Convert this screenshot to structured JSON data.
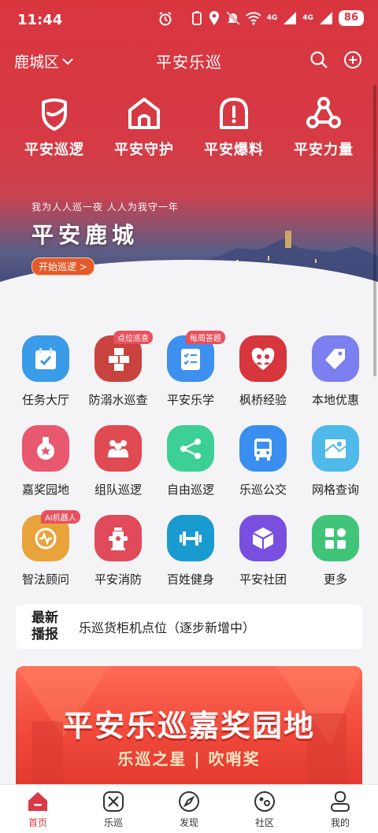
{
  "status_bar": {
    "time": "11:44",
    "battery": "86",
    "signal1": "4G",
    "signal2": "4G"
  },
  "navbar": {
    "district": "鹿城区",
    "title": "平安乐巡"
  },
  "quick_actions": [
    {
      "label": "平安巡逻",
      "icon": "shield-icon"
    },
    {
      "label": "平安守护",
      "icon": "house-icon"
    },
    {
      "label": "平安爆料",
      "icon": "alert-icon"
    },
    {
      "label": "平安力量",
      "icon": "network-icon"
    }
  ],
  "banner": {
    "subtitle": "我为人人巡一夜  人人为我守一年",
    "title": "平安鹿城",
    "button": "开始巡逻 >"
  },
  "grid": [
    [
      {
        "label": "任务大厅",
        "color": "#3a9be8",
        "icon": "calendar-check-icon"
      },
      {
        "label": "防溺水巡查",
        "color": "#c9433e",
        "icon": "cube-stack-icon",
        "badge": "点位巡查"
      },
      {
        "label": "平安乐学",
        "color": "#3d8ff0",
        "icon": "checklist-icon",
        "badge": "每周答题"
      },
      {
        "label": "枫桥经验",
        "color": "#d7363c",
        "icon": "people-heart-icon"
      },
      {
        "label": "本地优惠",
        "color": "#7b7ff0",
        "icon": "tag-icon"
      }
    ],
    [
      {
        "label": "嘉奖园地",
        "color": "#e8586f",
        "icon": "medal-icon"
      },
      {
        "label": "组队巡逻",
        "color": "#e04a52",
        "icon": "team-icon"
      },
      {
        "label": "自由巡逻",
        "color": "#3ccf96",
        "icon": "share-icon"
      },
      {
        "label": "乐巡公交",
        "color": "#3a8ef0",
        "icon": "bus-icon"
      },
      {
        "label": "网格查询",
        "color": "#4fb9ea",
        "icon": "map-icon"
      }
    ],
    [
      {
        "label": "智法顾问",
        "color": "#e8a33a",
        "icon": "ai-assistant-icon",
        "badge": "AI机器人"
      },
      {
        "label": "平安消防",
        "color": "#e04a5a",
        "icon": "hydrant-icon"
      },
      {
        "label": "百姓健身",
        "color": "#1a9bd0",
        "icon": "dumbbell-icon"
      },
      {
        "label": "平安社团",
        "color": "#7a4fe0",
        "icon": "box-icon"
      },
      {
        "label": "更多",
        "color": "#3fc47a",
        "icon": "apps-icon"
      }
    ]
  ],
  "news": {
    "tag_line1": "最新",
    "tag_line2": "播报",
    "text": "乐巡货柜机点位（逐步新增中）"
  },
  "promo": {
    "title": "平安乐巡嘉奖园地",
    "subtitle": "乐巡之星 | 吹哨奖"
  },
  "tabbar": [
    {
      "label": "首页",
      "icon": "home-icon",
      "active": true
    },
    {
      "label": "乐巡",
      "icon": "tools-icon"
    },
    {
      "label": "发现",
      "icon": "compass-icon"
    },
    {
      "label": "社区",
      "icon": "community-icon"
    },
    {
      "label": "我的",
      "icon": "profile-icon"
    }
  ]
}
